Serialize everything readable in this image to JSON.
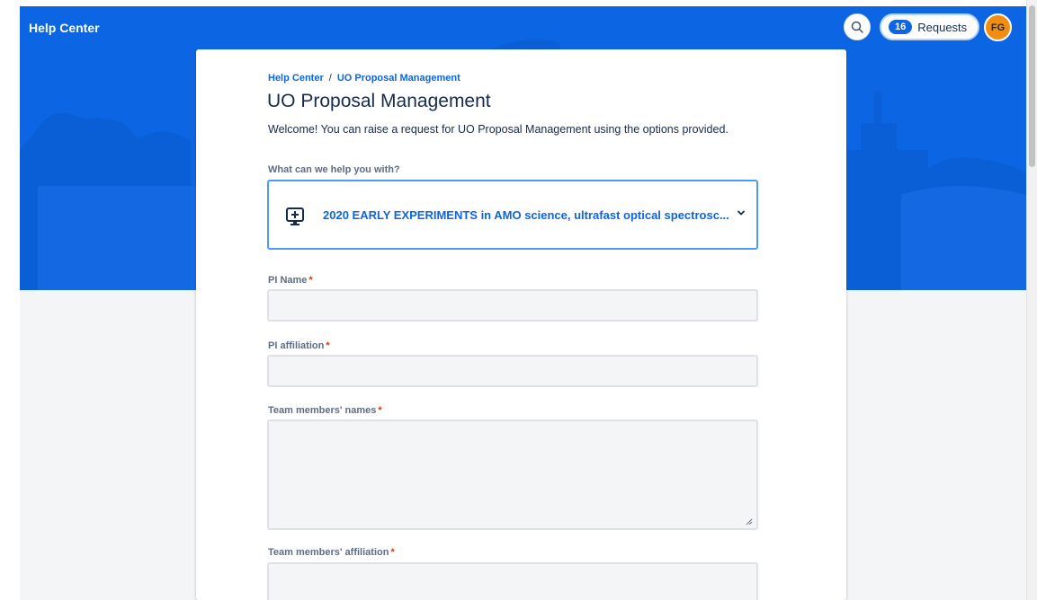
{
  "header": {
    "title": "Help Center",
    "requests_label": "Requests",
    "requests_count": "16",
    "avatar_initials": "FG"
  },
  "breadcrumb": {
    "home": "Help Center",
    "separator": "/",
    "current": "UO Proposal Management"
  },
  "page": {
    "title": "UO Proposal Management",
    "description": "Welcome! You can raise a request for UO Proposal Management using the options provided."
  },
  "request_type": {
    "label": "What can we help you with?",
    "selected": "2020 EARLY EXPERIMENTS in AMO science, ultrafast optical spectrosc...",
    "icon": "monitor-plus-icon"
  },
  "fields": {
    "pi_name": {
      "label": "PI Name",
      "required": "*",
      "value": ""
    },
    "pi_affiliation": {
      "label": "PI affiliation",
      "required": "*",
      "value": ""
    },
    "team_names": {
      "label": "Team members' names",
      "required": "*",
      "value": ""
    },
    "team_affiliation": {
      "label": "Team members' affiliation",
      "required": "*",
      "value": ""
    }
  },
  "colors": {
    "brand": "#0c66e4",
    "avatar": "#f18d13",
    "required": "#de350b"
  }
}
